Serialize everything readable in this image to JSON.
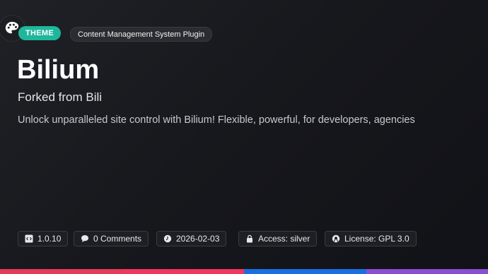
{
  "badge": "THEME",
  "category": "Content Management System Plugin",
  "title": "Bilium",
  "subtitle": "Forked from Bili",
  "description": "Unlock unparalleled site control with Bilium! Flexible, powerful, for developers, agencies",
  "meta": {
    "version": "1.0.10",
    "comments": "0 Comments",
    "date": "2026-02-03",
    "access": "Access: silver",
    "license": "License: GPL 3.0"
  },
  "icons": [
    "palette-icon",
    "code-file-icon",
    "comment-icon",
    "clock-icon",
    "lock-icon",
    "license-icon"
  ],
  "colors": {
    "accent": "#1fb79b",
    "bar": [
      "#e53a5a",
      "#f0365e",
      "#1a6fe0",
      "#8a4fd0"
    ]
  }
}
